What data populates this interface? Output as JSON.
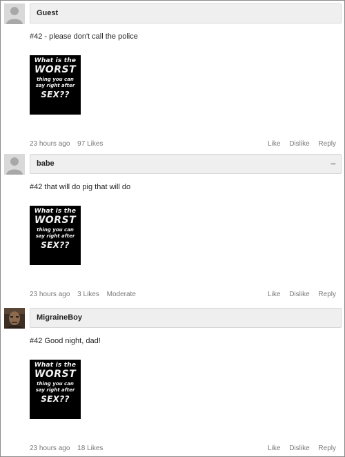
{
  "comments": [
    {
      "author": "Guest",
      "avatar": "default-avatar-icon",
      "text": "#42 - please don't call the police",
      "image_text": [
        "What is the",
        "WORST",
        "thing you can",
        "say right after",
        "SEX??"
      ],
      "time": "23 hours ago",
      "likes": "97 Likes",
      "actions": {
        "like": "Like",
        "dislike": "Dislike",
        "reply": "Reply"
      }
    },
    {
      "author": "babe",
      "avatar": "default-avatar-icon",
      "collapse": "−",
      "text": "#42 that will do pig that will do",
      "image_text": [
        "What is the",
        "WORST",
        "thing you can",
        "say right after",
        "SEX??"
      ],
      "time": "23 hours ago",
      "likes": "3 Likes",
      "moderate": "Moderate",
      "actions": {
        "like": "Like",
        "dislike": "Dislike",
        "reply": "Reply"
      }
    },
    {
      "author": "MigraineBoy",
      "avatar": "photo-avatar",
      "text": "#42 Good night, dad!",
      "image_text": [
        "What is the",
        "WORST",
        "thing you can",
        "say right after",
        "SEX??"
      ],
      "time": "23 hours ago",
      "likes": "18 Likes",
      "actions": {
        "like": "Like",
        "dislike": "Dislike",
        "reply": "Reply"
      }
    }
  ],
  "colors": {
    "name_bar": "#efefef",
    "meta_text": "#777777",
    "meme_bg": "#000000"
  }
}
